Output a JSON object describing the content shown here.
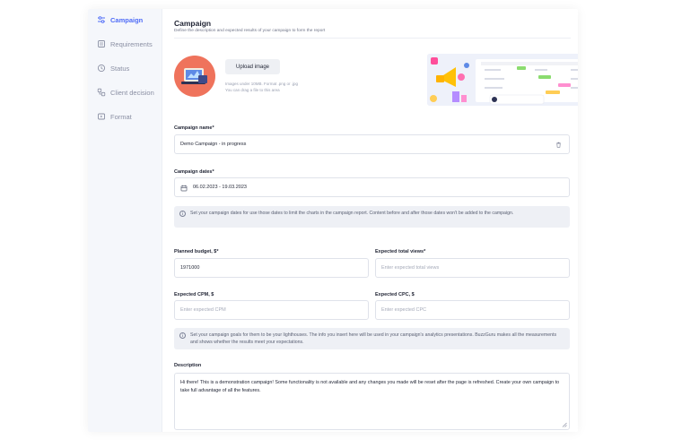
{
  "sidebar": {
    "items": [
      {
        "label": "Campaign",
        "icon": "sliders-icon",
        "active": true
      },
      {
        "label": "Requirements",
        "icon": "checklist-icon",
        "active": false
      },
      {
        "label": "Status",
        "icon": "status-icon",
        "active": false
      },
      {
        "label": "Client decision",
        "icon": "decision-icon",
        "active": false
      },
      {
        "label": "Format",
        "icon": "format-icon",
        "active": false
      }
    ]
  },
  "header": {
    "title": "Campaign",
    "subtitle": "Define the description and expected results of your campaign to form the report"
  },
  "image_upload": {
    "button_label": "Upload image",
    "hint_line1": "Images under 10MB. Format .png or .jpg",
    "hint_line2": "You can drag a file to this area"
  },
  "campaign_name": {
    "label": "Campaign name*",
    "value": "Demo Campaign - in progress"
  },
  "campaign_dates": {
    "label": "Campaign dates*",
    "value": "06.02.2023 - 19.03.2023",
    "info": "Set your campaign dates for use those dates to limit the charts in the campaign report. Content before and after those dates won't be added to the campaign."
  },
  "planned_budget": {
    "label": "Planned budget, $*",
    "value": "1971000"
  },
  "expected_views": {
    "label": "Expected total views*",
    "placeholder": "Enter expected total views"
  },
  "expected_cpm": {
    "label": "Expected CPM, $",
    "placeholder": "Enter expected CPM"
  },
  "expected_cpc": {
    "label": "Expected CPC, $",
    "placeholder": "Enter expected CPC"
  },
  "goals_info": "Set your campaign goals for them to be your lighthouses. The info you insert here will be used in your campaign's analytics presentations. BuzzGuru makes all the measurements and shows whether the results meet your expectations.",
  "description": {
    "label": "Description",
    "value": "Hi there! This is a demonstration campaign! Some functionality is not available and any changes you made will be reset after the page is refreshed. Create your own campaign to take full advantage of all the features."
  },
  "colors": {
    "accent": "#4f6cf7",
    "avatar_bg": "#ef735c",
    "sidebar_bg": "#f5f7fb"
  }
}
